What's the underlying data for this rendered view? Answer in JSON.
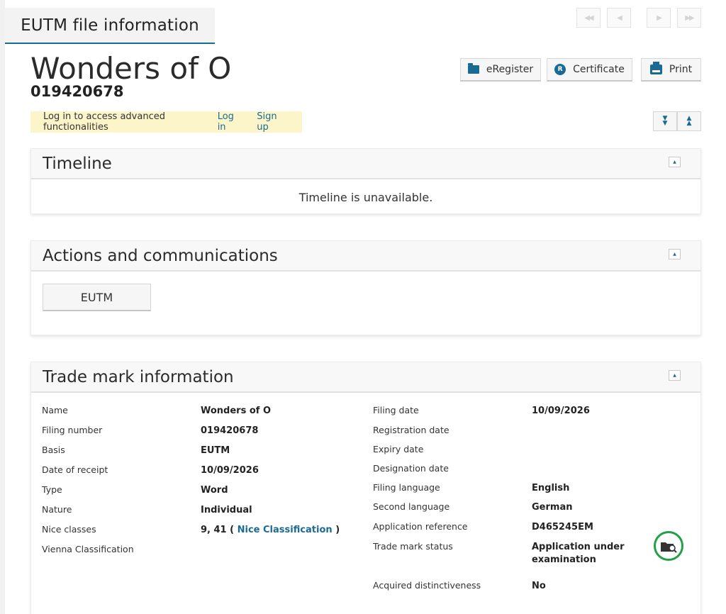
{
  "tab_header": {
    "title": "EUTM file information"
  },
  "navigation": {
    "first": "◀◀",
    "previous": "◀",
    "next": "▶",
    "last": "▶▶"
  },
  "mark": {
    "name": "Wonders of O",
    "number": "019420678"
  },
  "actions": {
    "eregister": "eRegister",
    "certificate": "Certificate",
    "print": "Print"
  },
  "login_banner": {
    "message": "Log in to access advanced functionalities",
    "login": "Log in",
    "signup": "Sign up"
  },
  "timeline": {
    "title": "Timeline",
    "message": "Timeline is unavailable."
  },
  "actions_section": {
    "title": "Actions and communications",
    "eutm_button": "EUTM"
  },
  "trade_mark": {
    "title": "Trade mark information",
    "left": [
      {
        "label": "Name",
        "value": "Wonders of O"
      },
      {
        "label": "Filing number",
        "value": "019420678"
      },
      {
        "label": "Basis",
        "value": "EUTM"
      },
      {
        "label": "Date of receipt",
        "value": "10/09/2026"
      },
      {
        "label": "Type",
        "value": "Word"
      },
      {
        "label": "Nature",
        "value": "Individual"
      },
      {
        "label": "Nice classes",
        "value": "9, 41 (",
        "link": "Nice Classification",
        "suffix": ")"
      },
      {
        "label": "Vienna Classification",
        "value": ""
      }
    ],
    "right": [
      {
        "label": "Filing date",
        "value": "10/09/2026"
      },
      {
        "label": "Registration date",
        "value": ""
      },
      {
        "label": "Expiry date",
        "value": ""
      },
      {
        "label": "Designation date",
        "value": ""
      },
      {
        "label": "Filing language",
        "value": "English"
      },
      {
        "label": "Second language",
        "value": "German"
      },
      {
        "label": "Application reference",
        "value": "D465245EM"
      },
      {
        "label": "Trade mark status",
        "value_line1": "Application under",
        "value_line2": "examination"
      },
      {
        "label": "Acquired distinctiveness",
        "value": "No"
      }
    ]
  },
  "colors": {
    "accent": "#1a6b94",
    "banner": "#fbf5c9",
    "status_green": "#22a046"
  },
  "icons": {
    "status": "folder-search-icon"
  }
}
